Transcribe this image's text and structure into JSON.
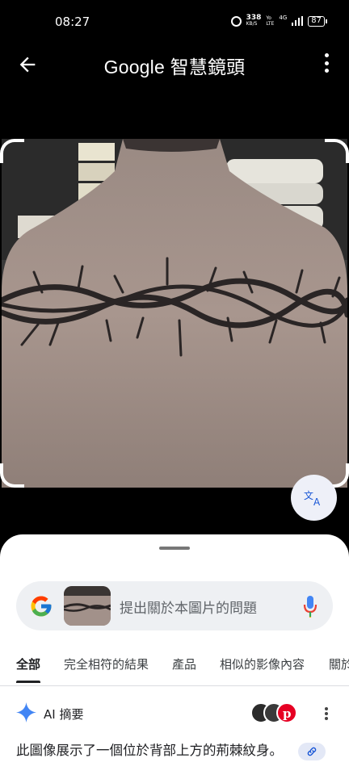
{
  "status_bar": {
    "time": "08:27",
    "net_speed_value": "338",
    "net_speed_unit": "KB/S",
    "network_top": "Yo",
    "network_bottom": "LTE",
    "network_type": "4G",
    "battery": "87",
    "icons": [
      "alarm-icon",
      "signal-icon",
      "battery-icon"
    ]
  },
  "app_bar": {
    "title_brand": "Google",
    "title_product": "智慧鏡頭"
  },
  "photo": {
    "description_icon": "tattoo-photo",
    "translate_label": "文A"
  },
  "search": {
    "placeholder": "提出關於本圖片的問題"
  },
  "tabs": [
    {
      "label": "全部",
      "active": true
    },
    {
      "label": "完全相符的結果",
      "active": false
    },
    {
      "label": "產品",
      "active": false
    },
    {
      "label": "相似的影像內容",
      "active": false
    },
    {
      "label": "關於",
      "active": false
    }
  ],
  "ai_overview": {
    "label": "AI 摘要",
    "summary": "此圖像展示了一個位於背部上方的荊棘紋身。"
  },
  "colors": {
    "accent_blue": "#4285f4",
    "pinterest_red": "#e60023",
    "sheet_bg": "#ffffff",
    "pill_bg": "#eef0f3"
  }
}
